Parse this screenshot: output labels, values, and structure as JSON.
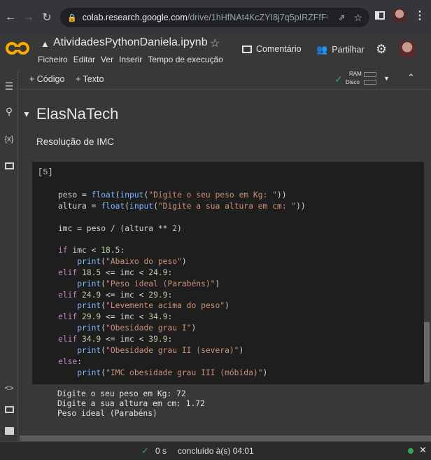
{
  "browser": {
    "url_host": "colab.research.google.com",
    "url_path": "/drive/1hHfNAt4KcZYI8j7q5pIRZFfFQc3P...",
    "profile_alt": "Perfil"
  },
  "header": {
    "doc_title": "AtividadesPythonDaniela.ipynb",
    "menu": [
      "Ficheiro",
      "Editar",
      "Ver",
      "Inserir",
      "Tempo de execução"
    ],
    "comment_label": "Comentário",
    "share_label": "Partilhar"
  },
  "toolbar": {
    "code_label": "+ Código",
    "text_label": "+ Texto",
    "ram_label": "RAM",
    "disk_label": "Disco"
  },
  "section": {
    "title": "ElasNaTech",
    "subtitle": "Resolução de IMC"
  },
  "cell": {
    "exec_count": "[5]",
    "output_lines": [
      "Digite o seu peso em Kg: 72",
      "Digite a sua altura em cm: 1.72",
      "Peso ideal (Parabéns)"
    ]
  },
  "status": {
    "time": "0 s",
    "completed": "concluído à(s) 04:01"
  },
  "colors": {
    "accent_orange": "#F9AB00",
    "status_green": "#34A853",
    "keyword": "#c586c0",
    "function": "#79b8ff",
    "string": "#ce9178"
  }
}
